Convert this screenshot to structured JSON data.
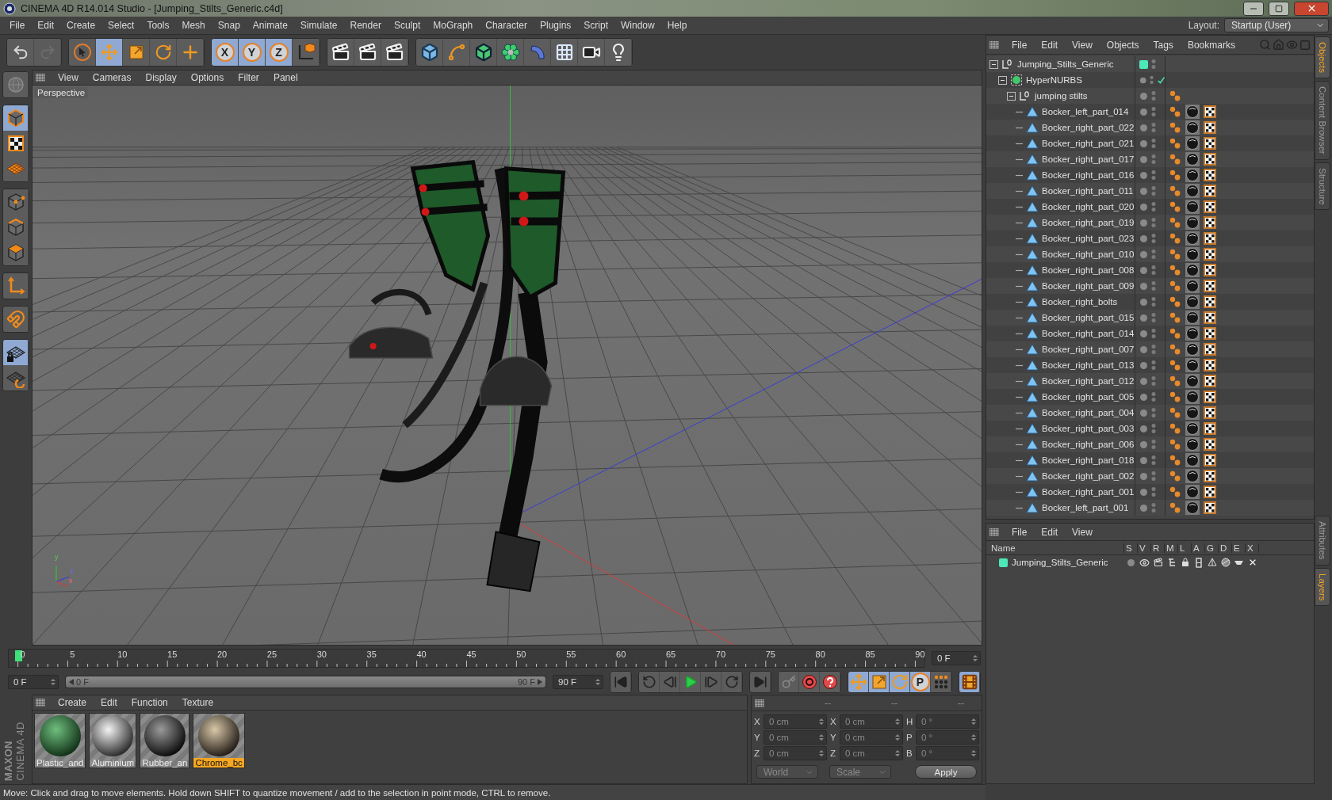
{
  "window": {
    "title": "CINEMA 4D R14.014 Studio - [Jumping_Stilts_Generic.c4d]"
  },
  "menu": [
    "File",
    "Edit",
    "Create",
    "Select",
    "Tools",
    "Mesh",
    "Snap",
    "Animate",
    "Simulate",
    "Render",
    "Sculpt",
    "MoGraph",
    "Character",
    "Plugins",
    "Script",
    "Window",
    "Help"
  ],
  "layout": {
    "label": "Layout:",
    "value": "Startup (User)"
  },
  "toolbar": [
    {
      "items": [
        {
          "kind": "undo",
          "selected": false,
          "disabled": false
        },
        {
          "kind": "redo",
          "selected": false,
          "disabled": true
        }
      ]
    },
    {
      "items": [
        {
          "kind": "select",
          "selected": false
        },
        {
          "kind": "move",
          "selected": true
        },
        {
          "kind": "scale",
          "selected": false
        },
        {
          "kind": "rotate",
          "selected": false
        },
        {
          "kind": "recent",
          "selected": false
        }
      ]
    },
    {
      "items": [
        {
          "kind": "axis",
          "label": "X",
          "selected": true
        },
        {
          "kind": "axis",
          "label": "Y",
          "selected": true
        },
        {
          "kind": "axis",
          "label": "Z",
          "selected": true
        },
        {
          "kind": "coord",
          "selected": false
        }
      ]
    },
    {
      "items": [
        {
          "kind": "render-view",
          "selected": false
        },
        {
          "kind": "render-picture",
          "selected": false
        },
        {
          "kind": "render-settings",
          "selected": false
        }
      ]
    },
    {
      "items": [
        {
          "kind": "cube",
          "selected": false
        },
        {
          "kind": "spline",
          "selected": false
        },
        {
          "kind": "nurbs",
          "selected": false
        },
        {
          "kind": "array",
          "selected": false
        },
        {
          "kind": "deformer",
          "selected": false
        },
        {
          "kind": "floor",
          "selected": false
        },
        {
          "kind": "camera",
          "selected": false
        },
        {
          "kind": "light",
          "selected": false
        }
      ]
    }
  ],
  "left_tools": [
    {
      "items": [
        {
          "kind": "solo",
          "selected": false
        }
      ]
    },
    {
      "items": [
        {
          "kind": "model",
          "selected": true
        },
        {
          "kind": "texture",
          "selected": false
        },
        {
          "kind": "workplane",
          "selected": false
        }
      ]
    },
    {
      "items": [
        {
          "kind": "points",
          "selected": false
        },
        {
          "kind": "edges",
          "selected": false
        },
        {
          "kind": "polygons",
          "selected": false
        }
      ]
    },
    {
      "items": [
        {
          "kind": "axis",
          "selected": false
        }
      ]
    },
    {
      "items": [
        {
          "kind": "snap",
          "selected": false
        }
      ]
    },
    {
      "items": [
        {
          "kind": "lock-workplane",
          "selected": true
        },
        {
          "kind": "workplane-sync",
          "selected": false
        }
      ]
    }
  ],
  "viewport": {
    "menu": [
      "View",
      "Cameras",
      "Display",
      "Options",
      "Filter",
      "Panel"
    ],
    "camera": "Perspective",
    "axis_labels": [
      "y",
      "z",
      "x"
    ]
  },
  "timeline": {
    "ticks": [
      "0",
      "5",
      "10",
      "15",
      "20",
      "25",
      "30",
      "35",
      "40",
      "45",
      "50",
      "55",
      "60",
      "65",
      "70",
      "75",
      "80",
      "85",
      "90"
    ],
    "level": 0,
    "current": "0 F",
    "start": "0 F",
    "range": {
      "start": "0 F",
      "end": "90 F",
      "level": 1
    },
    "end": "90 F"
  },
  "transport": [
    {
      "items": [
        {
          "kind": "first-frame",
          "selected": false
        }
      ]
    },
    {
      "items": [
        {
          "kind": "prev-key",
          "selected": false
        },
        {
          "kind": "prev-frame",
          "selected": false
        },
        {
          "kind": "play",
          "selected": false
        },
        {
          "kind": "next-frame",
          "selected": false
        },
        {
          "kind": "next-key",
          "selected": false
        }
      ]
    },
    {
      "items": [
        {
          "kind": "last-frame",
          "selected": false
        }
      ]
    },
    {
      "items": [
        {
          "kind": "autokey",
          "selected": false
        },
        {
          "kind": "record",
          "selected": false
        },
        {
          "kind": "help",
          "selected": false
        }
      ]
    },
    {
      "items": [
        {
          "kind": "key-move",
          "selected": true
        },
        {
          "kind": "key-scale",
          "selected": true
        },
        {
          "kind": "key-rotate",
          "selected": true
        },
        {
          "kind": "key-param",
          "label": "P",
          "selected": true
        },
        {
          "kind": "key-pla",
          "selected": false
        }
      ]
    },
    {
      "items": [
        {
          "kind": "timeline",
          "selected": true
        }
      ]
    }
  ],
  "logo": {
    "brand": "MAXON",
    "product": "CINEMA 4D"
  },
  "materials": {
    "menu": [
      "Create",
      "Edit",
      "Function",
      "Texture"
    ],
    "items": [
      {
        "name": "Plastic_and",
        "kind": "plastic",
        "selected": false
      },
      {
        "name": "Aluminium",
        "kind": "aluminium",
        "selected": false
      },
      {
        "name": "Rubber_an",
        "kind": "rubber",
        "selected": false
      },
      {
        "name": "Chrome_bc",
        "kind": "chrome",
        "selected": true
      }
    ]
  },
  "coordinates": {
    "headers": [
      "--",
      "--",
      "--"
    ],
    "fields": [
      {
        "label": "X",
        "value": "0 cm"
      },
      {
        "label": "X",
        "value": "0 cm"
      },
      {
        "label": "H",
        "value": "0 °"
      },
      {
        "label": "Y",
        "value": "0 cm"
      },
      {
        "label": "Y",
        "value": "0 cm"
      },
      {
        "label": "P",
        "value": "0 °"
      },
      {
        "label": "Z",
        "value": "0 cm"
      },
      {
        "label": "Z",
        "value": "0 cm"
      },
      {
        "label": "B",
        "value": "0 °"
      }
    ],
    "mode": "World",
    "scale": "Scale",
    "apply": "Apply"
  },
  "status_bar": "Move: Click and drag to move elements. Hold down SHIFT to quantize movement / add to the selection in point mode, CTRL to remove.",
  "objects": {
    "menu": [
      "File",
      "Edit",
      "View",
      "Objects",
      "Tags",
      "Bookmarks"
    ],
    "tree": [
      {
        "name": "Jumping_Stilts_Generic",
        "kind": "null",
        "color": "#4ce8b8",
        "expanded": true,
        "children": [
          {
            "name": "HyperNURBS",
            "kind": "nurbs",
            "enabled": true,
            "expanded": true,
            "children": [
              {
                "name": "jumping stilts",
                "kind": "null",
                "expanded": true,
                "tags": [
                  {
                    "kind": "phong"
                  }
                ],
                "children": [
                  {
                    "name": "Bocker_left_part_014",
                    "kind": "polygon",
                    "tags": [
                      {
                        "kind": "phong"
                      },
                      {
                        "kind": "material"
                      },
                      {
                        "kind": "uvw"
                      }
                    ]
                  },
                  {
                    "name": "Bocker_right_part_022",
                    "kind": "polygon",
                    "tags": [
                      {
                        "kind": "phong"
                      },
                      {
                        "kind": "material"
                      },
                      {
                        "kind": "uvw"
                      }
                    ]
                  },
                  {
                    "name": "Bocker_right_part_021",
                    "kind": "polygon",
                    "tags": [
                      {
                        "kind": "phong"
                      },
                      {
                        "kind": "material"
                      },
                      {
                        "kind": "uvw"
                      }
                    ]
                  },
                  {
                    "name": "Bocker_right_part_017",
                    "kind": "polygon",
                    "tags": [
                      {
                        "kind": "phong"
                      },
                      {
                        "kind": "material"
                      },
                      {
                        "kind": "uvw"
                      }
                    ]
                  },
                  {
                    "name": "Bocker_right_part_016",
                    "kind": "polygon",
                    "tags": [
                      {
                        "kind": "phong"
                      },
                      {
                        "kind": "material"
                      },
                      {
                        "kind": "uvw"
                      }
                    ]
                  },
                  {
                    "name": "Bocker_right_part_011",
                    "kind": "polygon",
                    "tags": [
                      {
                        "kind": "phong"
                      },
                      {
                        "kind": "material"
                      },
                      {
                        "kind": "uvw"
                      }
                    ]
                  },
                  {
                    "name": "Bocker_right_part_020",
                    "kind": "polygon",
                    "tags": [
                      {
                        "kind": "phong"
                      },
                      {
                        "kind": "material"
                      },
                      {
                        "kind": "uvw"
                      }
                    ]
                  },
                  {
                    "name": "Bocker_right_part_019",
                    "kind": "polygon",
                    "tags": [
                      {
                        "kind": "phong"
                      },
                      {
                        "kind": "material"
                      },
                      {
                        "kind": "uvw"
                      }
                    ]
                  },
                  {
                    "name": "Bocker_right_part_023",
                    "kind": "polygon",
                    "tags": [
                      {
                        "kind": "phong"
                      },
                      {
                        "kind": "material"
                      },
                      {
                        "kind": "uvw"
                      }
                    ]
                  },
                  {
                    "name": "Bocker_right_part_010",
                    "kind": "polygon",
                    "tags": [
                      {
                        "kind": "phong"
                      },
                      {
                        "kind": "material"
                      },
                      {
                        "kind": "uvw"
                      }
                    ]
                  },
                  {
                    "name": "Bocker_right_part_008",
                    "kind": "polygon",
                    "tags": [
                      {
                        "kind": "phong"
                      },
                      {
                        "kind": "material"
                      },
                      {
                        "kind": "uvw"
                      }
                    ]
                  },
                  {
                    "name": "Bocker_right_part_009",
                    "kind": "polygon",
                    "tags": [
                      {
                        "kind": "phong"
                      },
                      {
                        "kind": "material"
                      },
                      {
                        "kind": "uvw"
                      }
                    ]
                  },
                  {
                    "name": "Bocker_right_bolts",
                    "kind": "polygon",
                    "tags": [
                      {
                        "kind": "phong"
                      },
                      {
                        "kind": "material"
                      },
                      {
                        "kind": "uvw"
                      }
                    ]
                  },
                  {
                    "name": "Bocker_right_part_015",
                    "kind": "polygon",
                    "tags": [
                      {
                        "kind": "phong"
                      },
                      {
                        "kind": "material"
                      },
                      {
                        "kind": "uvw"
                      }
                    ]
                  },
                  {
                    "name": "Bocker_right_part_014",
                    "kind": "polygon",
                    "tags": [
                      {
                        "kind": "phong"
                      },
                      {
                        "kind": "material"
                      },
                      {
                        "kind": "uvw"
                      }
                    ]
                  },
                  {
                    "name": "Bocker_right_part_007",
                    "kind": "polygon",
                    "tags": [
                      {
                        "kind": "phong"
                      },
                      {
                        "kind": "material"
                      },
                      {
                        "kind": "uvw"
                      }
                    ]
                  },
                  {
                    "name": "Bocker_right_part_013",
                    "kind": "polygon",
                    "tags": [
                      {
                        "kind": "phong"
                      },
                      {
                        "kind": "material"
                      },
                      {
                        "kind": "uvw"
                      }
                    ]
                  },
                  {
                    "name": "Bocker_right_part_012",
                    "kind": "polygon",
                    "tags": [
                      {
                        "kind": "phong"
                      },
                      {
                        "kind": "material"
                      },
                      {
                        "kind": "uvw"
                      }
                    ]
                  },
                  {
                    "name": "Bocker_right_part_005",
                    "kind": "polygon",
                    "tags": [
                      {
                        "kind": "phong"
                      },
                      {
                        "kind": "material"
                      },
                      {
                        "kind": "uvw"
                      }
                    ]
                  },
                  {
                    "name": "Bocker_right_part_004",
                    "kind": "polygon",
                    "tags": [
                      {
                        "kind": "phong"
                      },
                      {
                        "kind": "material"
                      },
                      {
                        "kind": "uvw"
                      }
                    ]
                  },
                  {
                    "name": "Bocker_right_part_003",
                    "kind": "polygon",
                    "tags": [
                      {
                        "kind": "phong"
                      },
                      {
                        "kind": "material"
                      },
                      {
                        "kind": "uvw"
                      }
                    ]
                  },
                  {
                    "name": "Bocker_right_part_006",
                    "kind": "polygon",
                    "tags": [
                      {
                        "kind": "phong"
                      },
                      {
                        "kind": "material"
                      },
                      {
                        "kind": "uvw"
                      }
                    ]
                  },
                  {
                    "name": "Bocker_right_part_018",
                    "kind": "polygon",
                    "tags": [
                      {
                        "kind": "phong"
                      },
                      {
                        "kind": "material"
                      },
                      {
                        "kind": "uvw"
                      }
                    ]
                  },
                  {
                    "name": "Bocker_right_part_002",
                    "kind": "polygon",
                    "tags": [
                      {
                        "kind": "phong"
                      },
                      {
                        "kind": "material"
                      },
                      {
                        "kind": "uvw"
                      }
                    ]
                  },
                  {
                    "name": "Bocker_right_part_001",
                    "kind": "polygon",
                    "tags": [
                      {
                        "kind": "phong"
                      },
                      {
                        "kind": "material"
                      },
                      {
                        "kind": "uvw"
                      }
                    ]
                  },
                  {
                    "name": "Bocker_left_part_001",
                    "kind": "polygon",
                    "tags": [
                      {
                        "kind": "phong"
                      },
                      {
                        "kind": "material"
                      },
                      {
                        "kind": "uvw"
                      }
                    ]
                  }
                ]
              }
            ]
          }
        ]
      }
    ]
  },
  "layers": {
    "menu": [
      "File",
      "Edit",
      "View"
    ],
    "columns": [
      "Name",
      "S",
      "V",
      "R",
      "M",
      "L",
      "A",
      "G",
      "D",
      "E",
      "X"
    ],
    "rows": [
      {
        "name": "Jumping_Stilts_Generic",
        "color": "#4ce8b8"
      }
    ]
  },
  "side_tabs": {
    "upper": [
      {
        "label": "Objects",
        "selected": true
      },
      {
        "label": "Content Browser",
        "selected": false
      },
      {
        "label": "Structure",
        "selected": false
      }
    ],
    "lower": [
      {
        "label": "Attributes",
        "selected": false
      },
      {
        "label": "Layers",
        "selected": true
      }
    ]
  }
}
